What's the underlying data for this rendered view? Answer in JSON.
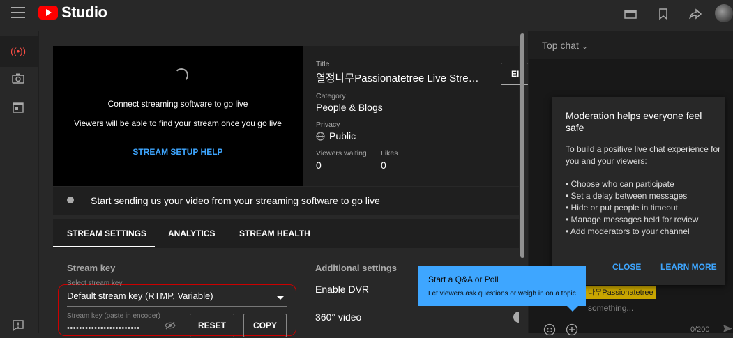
{
  "app": {
    "brand": "Studio"
  },
  "preview": {
    "line1": "Connect streaming software to go live",
    "line2": "Viewers will be able to find your stream once you go live",
    "help": "STREAM SETUP HELP"
  },
  "info": {
    "title_label": "Title",
    "title_value": "열정나무Passionatetree Live Stre…",
    "edit_label": "EI",
    "category_label": "Category",
    "category_value": "People & Blogs",
    "privacy_label": "Privacy",
    "privacy_value": "Public",
    "viewers_label": "Viewers waiting",
    "viewers_value": "0",
    "likes_label": "Likes",
    "likes_value": "0"
  },
  "status": {
    "text": "Start sending us your video from your streaming software to go live"
  },
  "tabs": [
    "STREAM SETTINGS",
    "ANALYTICS",
    "STREAM HEALTH"
  ],
  "stream_key": {
    "section_title": "Stream key",
    "select_label": "Select stream key",
    "select_value": "Default stream key (RTMP, Variable)",
    "key_label": "Stream key (paste in encoder)",
    "key_value": "••••••••••••••••••••••••",
    "reset": "RESET",
    "copy": "COPY"
  },
  "additional": {
    "section_title": "Additional settings",
    "dvr": "Enable DVR",
    "video360": "360° video"
  },
  "chat": {
    "title": "Top chat",
    "user": "나무Passionatetree",
    "input_placeholder": "something...",
    "counter": "0/200"
  },
  "modal": {
    "title": "Moderation helps everyone feel safe",
    "body": "To build a positive live chat experience for you and your viewers:",
    "bullets": [
      "• Choose who can participate",
      "• Set a delay between messages",
      "• Hide or put people in timeout",
      "• Manage messages held for review",
      "• Add moderators to your channel"
    ],
    "close": "CLOSE",
    "learn_more": "LEARN MORE"
  },
  "tooltip": {
    "title": "Start a Q&A or Poll",
    "subtitle": "Let viewers ask questions or weigh in on a topic"
  },
  "colors": {
    "brand_red": "#ff0000",
    "accent_blue": "#3ea6ff",
    "highlight_border": "#cc0000"
  }
}
